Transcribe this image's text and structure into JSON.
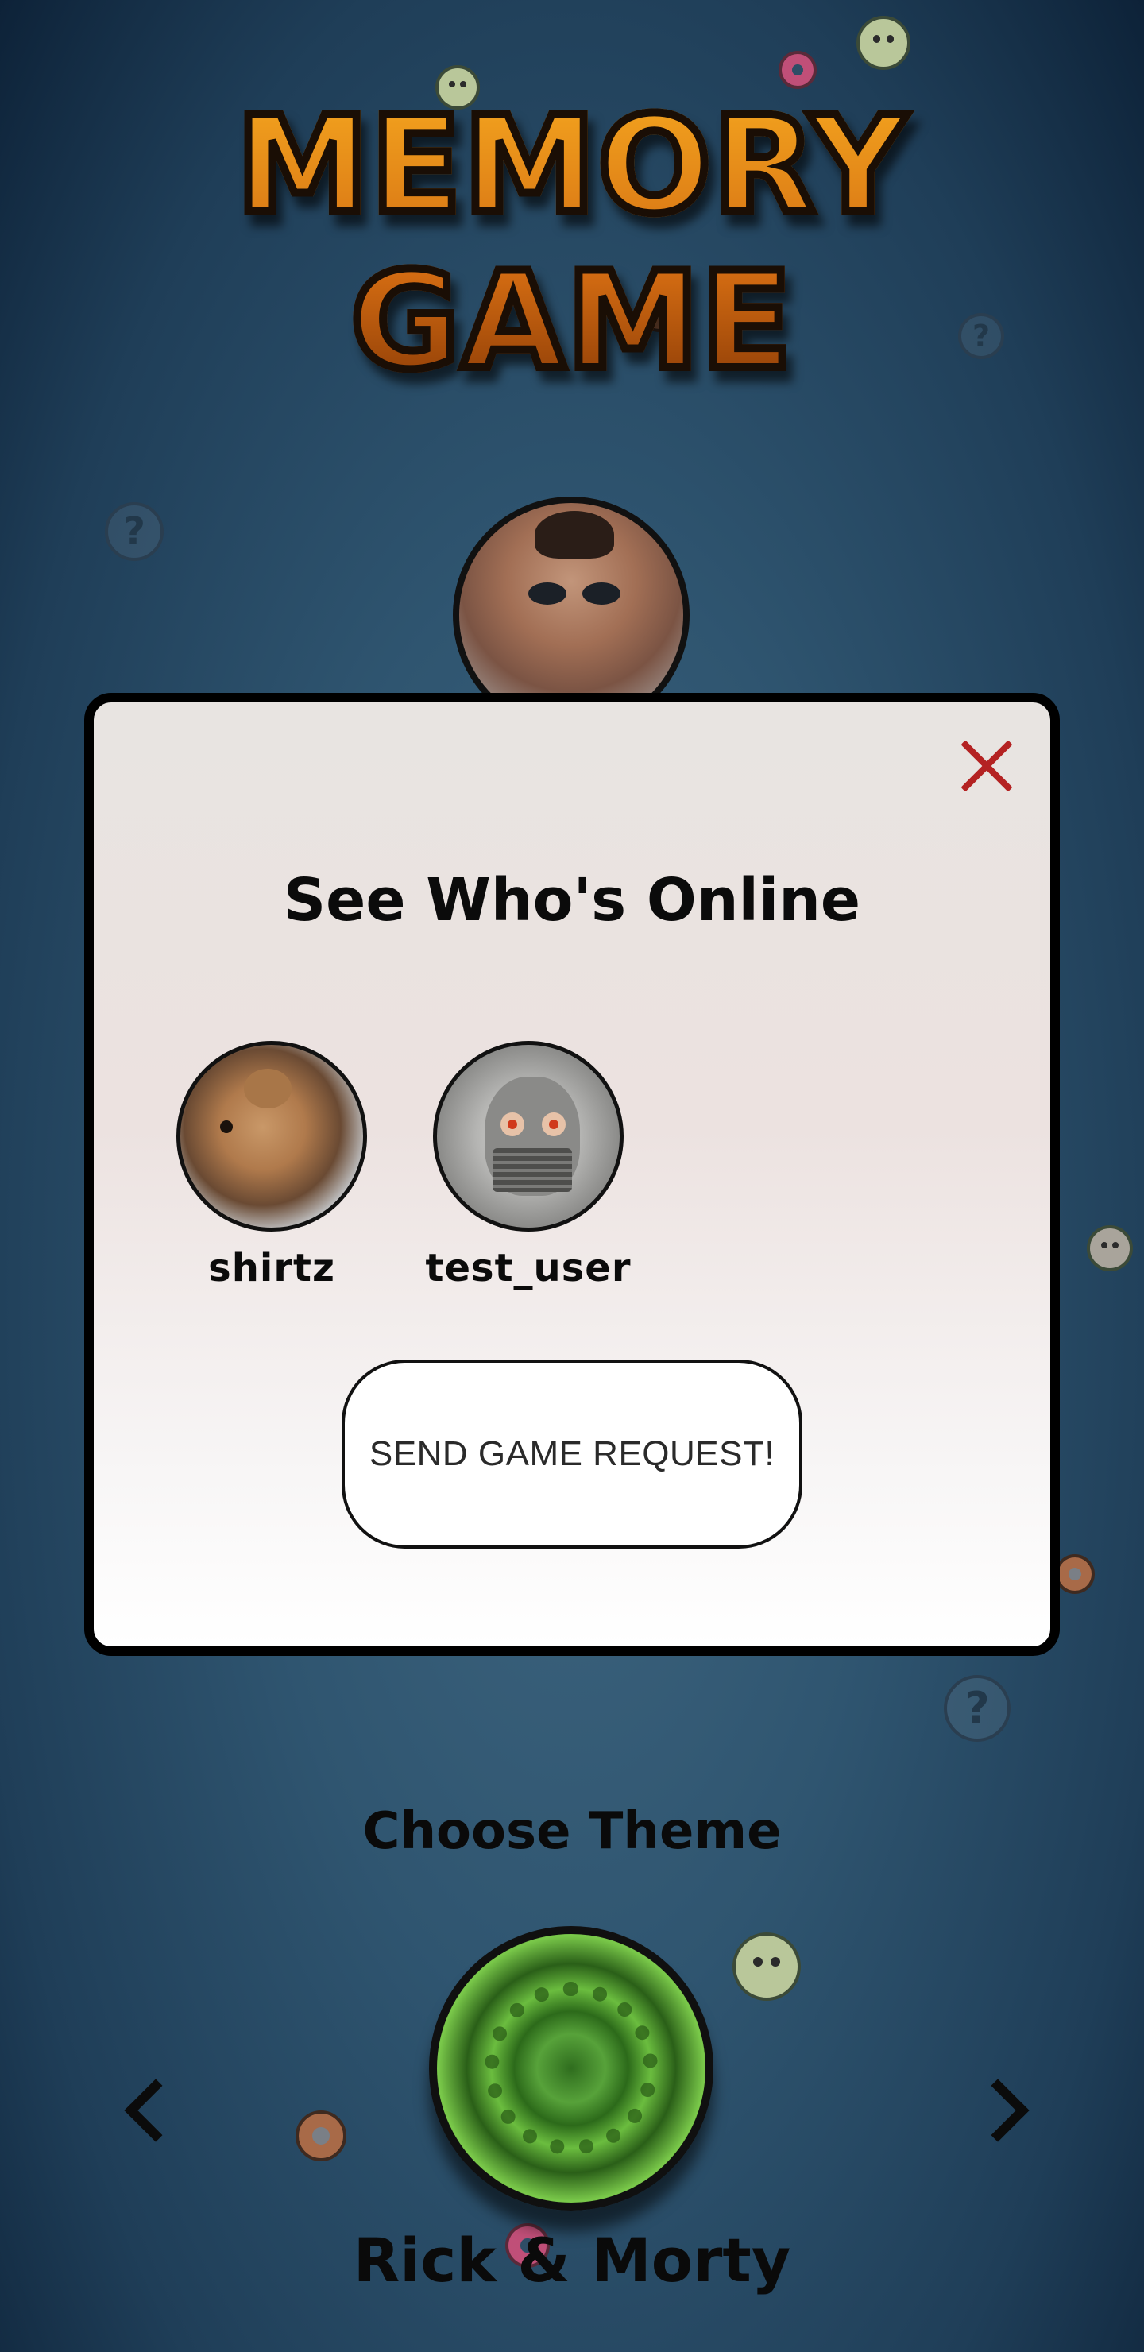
{
  "app": {
    "title": "MEMORY GAME"
  },
  "modal": {
    "title": "See Who's Online",
    "users": [
      {
        "name": "shirtz"
      },
      {
        "name": "test_user"
      }
    ],
    "send_button_label": "SEND GAME REQUEST!",
    "close_icon": "close-icon"
  },
  "theme": {
    "heading": "Choose Theme",
    "current": "Rick & Morty",
    "prev_icon": "chevron-left-icon",
    "next_icon": "chevron-right-icon"
  },
  "colors": {
    "background": "#2f5570",
    "title_orange": "#e08a14",
    "close_red": "#b42222",
    "modal_bg": "#ece6e4"
  }
}
